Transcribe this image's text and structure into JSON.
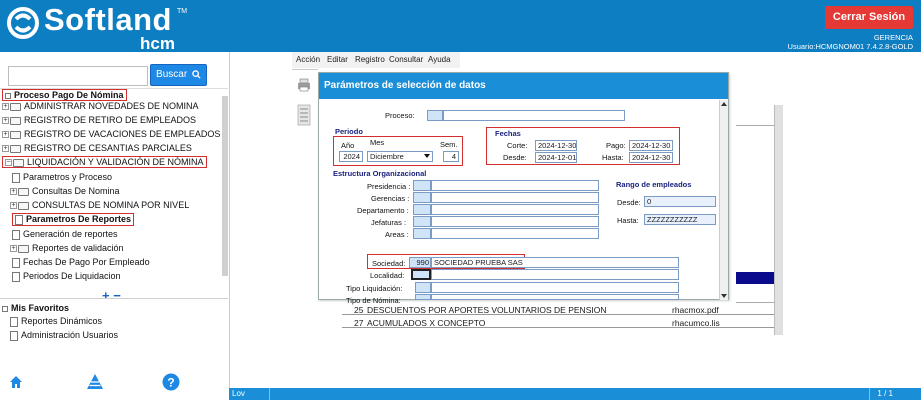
{
  "header": {
    "brand": "Softland",
    "brand_tm": "TM",
    "brand_sub": "hcm",
    "logout_label": "Cerrar Sesión",
    "company": "GERENCIA",
    "user_line": "Usuario:HCMGNOM01 7.4.2.8-GOLD"
  },
  "search": {
    "value": "",
    "button_label": "Buscar"
  },
  "tree": {
    "root": "Proceso Pago De Nómina",
    "items": [
      "ADMINISTRAR NOVEDADES DE NOMINA",
      "REGISTRO DE RETIRO DE EMPLEADOS",
      "REGISTRO DE VACACIONES DE EMPLEADOS",
      "REGISTRO DE CESANTIAS PARCIALES",
      "LIQUIDACIÓN Y VALIDACIÓN DE NÓMINA"
    ],
    "sub_items": [
      "Parametros y Proceso",
      "Consultas De Nomina",
      "CONSULTAS DE NOMINA POR NIVEL",
      "Parametros De Reportes",
      "Generación de reportes",
      "Reportes de validación",
      "Fechas De Pago Por Empleado",
      "Periodos De Liquidacion"
    ],
    "expand_controls": "+ −"
  },
  "favorites": {
    "title": "Mis Favoritos",
    "items": [
      "Reportes Dinámicos",
      "Administración Usuarios"
    ]
  },
  "menu": {
    "items": [
      "Acción",
      "Editar",
      "Registro",
      "Consultar",
      "Ayuda"
    ]
  },
  "dialog": {
    "title": "Parámetros de selección de datos",
    "proceso_label": "Proceso:",
    "periodo": {
      "title": "Periodo",
      "anio_label": "Año",
      "anio_value": "2024",
      "mes_label": "Mes",
      "mes_value": "Diciembre",
      "sem_label": "Sem.",
      "sem_value": "4"
    },
    "fechas": {
      "title": "Fechas",
      "corte_label": "Corte:",
      "corte_value": "2024-12-30",
      "desde_label": "Desde:",
      "desde_value": "2024-12-01",
      "pago_label": "Pago:",
      "pago_value": "2024-12-30",
      "hasta_label": "Hasta:",
      "hasta_value": "2024-12-30"
    },
    "estructura": {
      "title": "Estructura Organizacional",
      "labels": [
        "Presidencia",
        "Gerencias",
        "Departamento",
        "Jefaturas",
        "Areas"
      ]
    },
    "rango": {
      "title": "Rango de empleados",
      "desde_label": "Desde:",
      "desde_value": "0",
      "hasta_label": "Hasta:",
      "hasta_value": "ZZZZZZZZZZZ"
    },
    "sociedad_label": "Sociedad:",
    "sociedad_code": "990",
    "sociedad_name": "SOCIEDAD  PRUEBA SAS",
    "localidad_label": "Localidad:",
    "tipo_liq_label": "Tipo Liquidación:",
    "tipo_nom_label": "Tipo de Nómina:"
  },
  "background_table": {
    "rows": [
      {
        "num": "25",
        "name": "DESCUENTOS POR APORTES VOLUNTARIOS DE PENSION",
        "file": "rhacmox.pdf"
      },
      {
        "num": "27",
        "name": "ACUMULADOS X CONCEPTO",
        "file": "rhacumco.lis"
      }
    ]
  },
  "status": {
    "left": "Lov",
    "right": "1 / 1"
  },
  "colors": {
    "header": "#0e7ec2",
    "accent": "#1a8fd8",
    "danger": "#e53935",
    "highlight": "#d32f2f"
  },
  "icons": [
    "softland-logo-icon",
    "home-icon",
    "tree-toggle-icon",
    "help-icon",
    "folder-icon",
    "document-icon"
  ]
}
